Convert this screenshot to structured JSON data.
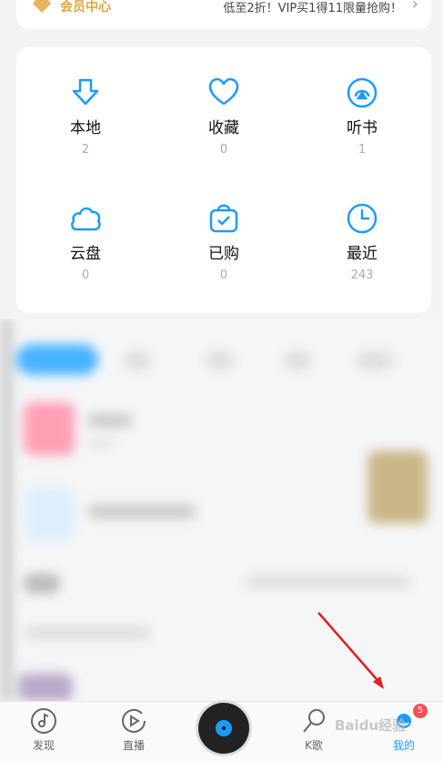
{
  "vip": {
    "title": "会员中心",
    "promo": "低至2折！VIP买1得11限量抢购！",
    "arrow": "›",
    "icon": "diamond-icon",
    "accent": "#e0a53a"
  },
  "library": {
    "items": [
      {
        "label": "本地",
        "count": "2",
        "icon": "download-icon"
      },
      {
        "label": "收藏",
        "count": "0",
        "icon": "heart-icon"
      },
      {
        "label": "听书",
        "count": "1",
        "icon": "audiobook-icon"
      },
      {
        "label": "云盘",
        "count": "0",
        "icon": "cloud-icon"
      },
      {
        "label": "已购",
        "count": "0",
        "icon": "purchased-bag-icon"
      },
      {
        "label": "最近",
        "count": "243",
        "icon": "clock-icon"
      }
    ],
    "accent": "#1a9cff"
  },
  "tabbar": {
    "tabs": [
      {
        "label": "发现",
        "icon": "discover-note-icon",
        "active": false
      },
      {
        "label": "直播",
        "icon": "live-play-icon",
        "active": false
      },
      {
        "label": "K歌",
        "icon": "microphone-icon",
        "active": false
      },
      {
        "label": "我的",
        "icon": "profile-icon",
        "active": true
      }
    ],
    "badge": "5",
    "center_icon": "vinyl-disc-icon"
  },
  "watermark": "Baidu经验"
}
